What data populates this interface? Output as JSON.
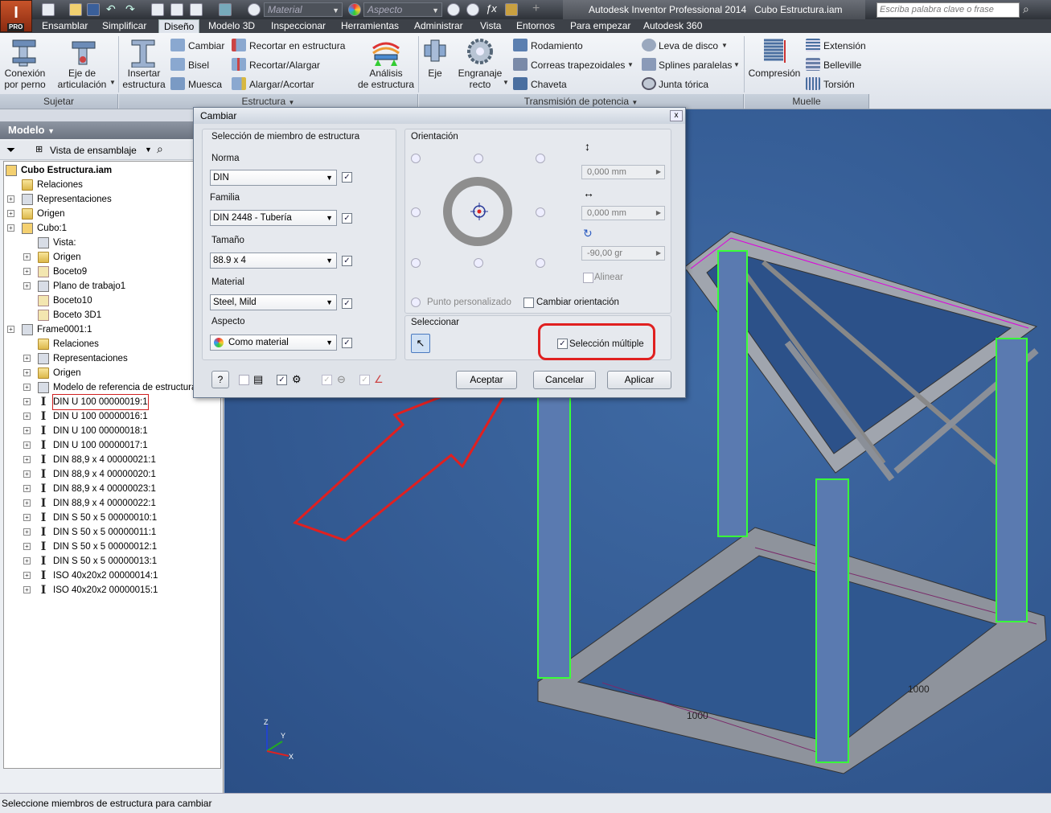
{
  "window": {
    "app_title": "Autodesk Inventor Professional 2014",
    "doc_title": "Cubo Estructura.iam",
    "app_badge": "PRO",
    "material_placeholder": "Material",
    "aspect_placeholder": "Aspecto",
    "help_search_placeholder": "Escriba palabra clave o frase"
  },
  "menu_tabs": [
    "Ensamblar",
    "Simplificar",
    "Diseño",
    "Modelo 3D",
    "Inspeccionar",
    "Herramientas",
    "Administrar",
    "Vista",
    "Entornos",
    "Para empezar",
    "Autodesk 360"
  ],
  "ribbon": {
    "sujetar": {
      "btn1": "Conexión\npor perno",
      "btn2": "Eje de\narticulación",
      "footer": "Sujetar"
    },
    "estructura": {
      "insertar": "Insertar\nestructura",
      "cambiar": "Cambiar",
      "bisel": "Bisel",
      "muesca": "Muesca",
      "recortar_estructura": "Recortar en estructura",
      "recortar_alargar": "Recortar/Alargar",
      "alargar_acortar": "Alargar/Acortar",
      "analisis": "Análisis\nde estructura",
      "footer": "Estructura"
    },
    "transmision": {
      "eje": "Eje",
      "engranaje": "Engranaje\nrecto",
      "rodamiento": "Rodamiento",
      "correas": "Correas trapezoidales",
      "chaveta": "Chaveta",
      "leva": "Leva de disco",
      "splines": "Splines paralelas",
      "junta": "Junta tórica",
      "footer": "Transmisión de potencia"
    },
    "muelle": {
      "compresion": "Compresión",
      "extension": "Extensión",
      "belleville": "Belleville",
      "torsion": "Torsión",
      "footer": "Muelle"
    }
  },
  "browser": {
    "title": "Modelo",
    "view_label": "Vista de ensamblaje",
    "items": [
      {
        "label": "Cubo Estructura.iam",
        "bold": true
      },
      {
        "label": "Relaciones"
      },
      {
        "label": "Representaciones"
      },
      {
        "label": "Origen"
      },
      {
        "label": "Cubo:1"
      },
      {
        "label": "Vista:"
      },
      {
        "label": "Origen"
      },
      {
        "label": "Boceto9"
      },
      {
        "label": "Plano de trabajo1"
      },
      {
        "label": "Boceto10"
      },
      {
        "label": "Boceto 3D1"
      },
      {
        "label": "Frame0001:1"
      },
      {
        "label": "Relaciones"
      },
      {
        "label": "Representaciones"
      },
      {
        "label": "Origen"
      },
      {
        "label": "Modelo de referencia de estructura"
      },
      {
        "label": "DIN U 100 00000019:1"
      },
      {
        "label": "DIN U 100 00000016:1"
      },
      {
        "label": "DIN U 100 00000018:1"
      },
      {
        "label": "DIN U 100 00000017:1"
      },
      {
        "label": "DIN 88,9 x 4 00000021:1"
      },
      {
        "label": "DIN 88,9 x 4 00000020:1"
      },
      {
        "label": "DIN 88,9 x 4 00000023:1"
      },
      {
        "label": "DIN 88,9 x 4 00000022:1"
      },
      {
        "label": "DIN S 50 x 5 00000010:1"
      },
      {
        "label": "DIN S 50 x 5 00000011:1"
      },
      {
        "label": "DIN S 50 x 5 00000012:1"
      },
      {
        "label": "DIN S 50 x 5 00000013:1"
      },
      {
        "label": "ISO 40x20x2 00000014:1"
      },
      {
        "label": "ISO 40x20x2 00000015:1"
      }
    ]
  },
  "dialog": {
    "title": "Cambiar",
    "close": "x",
    "member_group": "Selección de miembro de estructura",
    "norma_label": "Norma",
    "norma_value": "DIN",
    "familia_label": "Familia",
    "familia_value": "DIN 2448 - Tubería",
    "tamano_label": "Tamaño",
    "tamano_value": "88.9 x 4",
    "material_label": "Material",
    "material_value": "Steel, Mild",
    "aspecto_label": "Aspecto",
    "aspecto_value": "Como material",
    "orientation_group": "Orientación",
    "offset_y": "0,000 mm",
    "offset_x": "0,000 mm",
    "rotation": "-90,00 gr",
    "alinear": "Alinear",
    "punto_personalizado": "Punto personalizado",
    "cambiar_orientacion": "Cambiar orientación",
    "select_group": "Seleccionar",
    "multi_select": "Selección múltiple",
    "ok": "Aceptar",
    "cancel": "Cancelar",
    "apply": "Aplicar",
    "help": "?"
  },
  "viewport": {
    "dim1": "1000",
    "dim2": "1000",
    "axis_x": "X",
    "axis_y": "Y",
    "axis_z": "Z"
  },
  "status": "Seleccione miembros de estructura para cambiar"
}
